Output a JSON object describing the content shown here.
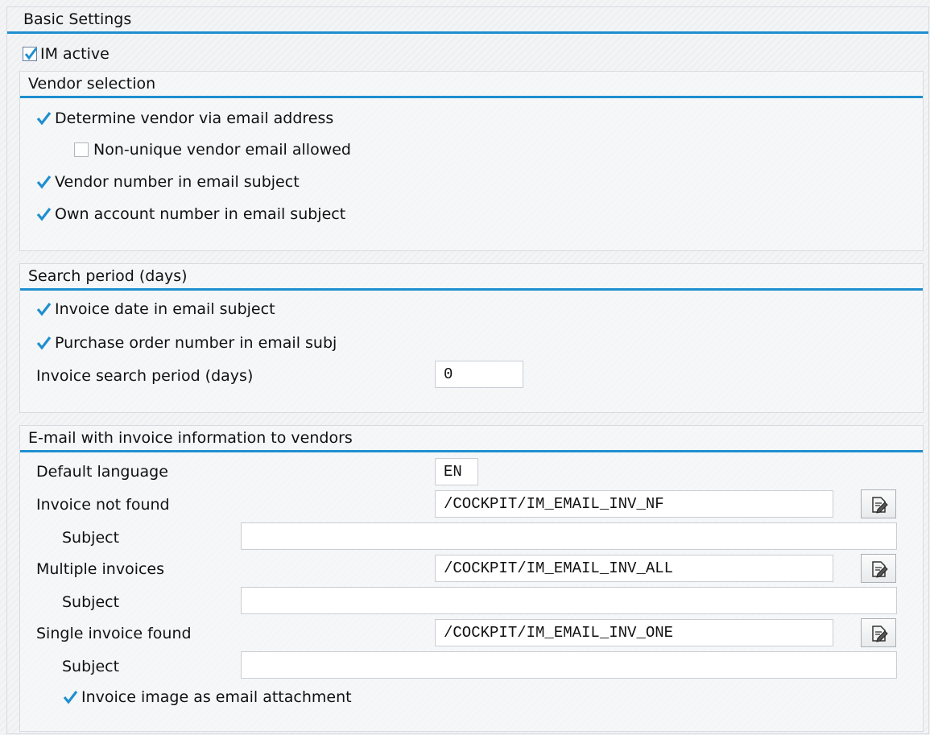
{
  "basic": {
    "title": "Basic Settings",
    "im_active": {
      "label": "IM active",
      "checked": true
    }
  },
  "vendor": {
    "title": "Vendor selection",
    "via_email": {
      "label": "Determine vendor via email address",
      "checked": true
    },
    "non_unique": {
      "label": "Non-unique vendor email allowed",
      "checked": false
    },
    "vendor_num": {
      "label": "Vendor number in email subject",
      "checked": true
    },
    "own_account": {
      "label": "Own account number in email subject",
      "checked": true
    }
  },
  "search": {
    "title": "Search period (days)",
    "invoice_date": {
      "label": "Invoice date in email subject",
      "checked": true
    },
    "po_number": {
      "label": "Purchase order number in email subj",
      "checked": true
    },
    "period_label": "Invoice search period (days)",
    "period_value": "0"
  },
  "email": {
    "title": "E-mail with invoice information to vendors",
    "default_language_label": "Default language",
    "default_language_value": "EN",
    "not_found_label": "Invoice not found",
    "not_found_value": "/COCKPIT/IM_EMAIL_INV_NF",
    "subject_label": "Subject",
    "subject_nf": "",
    "multiple_label": "Multiple invoices",
    "multiple_value": "/COCKPIT/IM_EMAIL_INV_ALL",
    "subject_all": "",
    "single_label": "Single invoice found",
    "single_value": "/COCKPIT/IM_EMAIL_INV_ONE",
    "subject_one": "",
    "attachment": {
      "label": "Invoice image as email attachment",
      "checked": true
    },
    "edit_icon": "edit-document-icon"
  },
  "colors": {
    "accent": "#1f8fcf",
    "check": "#1f8fcf"
  }
}
